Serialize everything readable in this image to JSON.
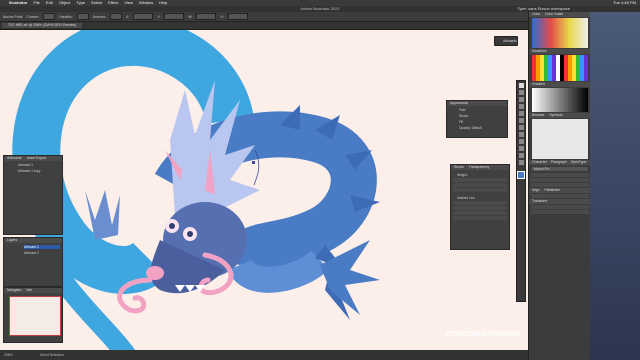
{
  "menubar": {
    "app_name": "Illustrator",
    "menus": [
      "File",
      "Edit",
      "Object",
      "Type",
      "Select",
      "Effect",
      "View",
      "Window",
      "Help"
    ],
    "clock": "Tue 4:49 PM"
  },
  "window": {
    "title": "Adobe Illustrator 2021",
    "workspace": "Tyler: sans Elsson workspace"
  },
  "controlbar": {
    "selection_label": "Anchor Point",
    "items": [
      "Convert:",
      "Handles:",
      "Anchors:",
      "X:",
      "Y:",
      "W:",
      "H:"
    ]
  },
  "document_tab": {
    "label": "TCF-HBD.ai* @ 206% (CMYK/GPU Preview)"
  },
  "canvas": {
    "background": "#fcefea",
    "dragon_blue": "#4a7cc6",
    "ring_blue": "#3fa7e0",
    "tail_blue": "#5e8fd4",
    "pink": "#f2a3c4",
    "accent_dark": "#2f3e70"
  },
  "artboard_button": {
    "label": "Artboards"
  },
  "appearance_panel": {
    "title": "Appearance",
    "items": [
      "Path",
      "Stroke",
      "Fill",
      "Opacity: Default"
    ]
  },
  "stroke_panel": {
    "title": "Stroke",
    "second_tab": "Transparency",
    "weight_label": "Weight:",
    "dashed_label": "Dashed Line"
  },
  "artboards_panel": {
    "title": "Artboards",
    "second_tab": "Asset Export",
    "items": [
      "Artboard 1",
      "Artboard 1 copy"
    ]
  },
  "layers_panel": {
    "title": "Layers",
    "items": [
      "Artboard 1",
      "Artboard 2"
    ]
  },
  "navigator_panel": {
    "title": "Navigator",
    "second_tab": "Info"
  },
  "right_panels": {
    "color_title": "Color",
    "color_tab2": "Color Guide",
    "swatches_title": "Swatches",
    "gradient_title": "Gradient",
    "brushes_title": "Brushes",
    "symbols_tab": "Symbols",
    "character_title": "Character",
    "paragraph_tab": "Paragraph",
    "opentype_tab": "OpenType",
    "font_value": "Myriad Pro",
    "align_title": "Align",
    "pathfinder_tab": "Pathfinder",
    "transform_title": "Transform"
  },
  "statusbar": {
    "zoom": "206%",
    "tool": "Direct Selection"
  },
  "watermark": "@THECREATIVEPAIN"
}
